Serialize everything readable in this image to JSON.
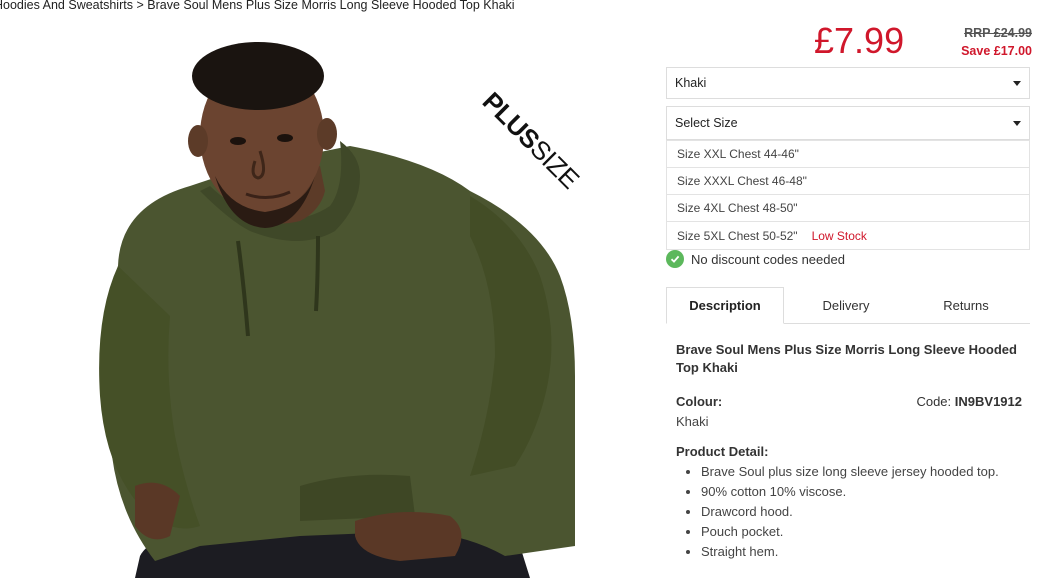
{
  "breadcrumb": {
    "parent": "Hoodies And Sweatshirts",
    "separator": ">",
    "current": "Brave Soul Mens Plus Size Morris Long Sleeve Hooded Top Khaki"
  },
  "badge": {
    "bold": "PLUS",
    "light": "SIZE"
  },
  "price": {
    "now": "£7.99",
    "rrp": "RRP £24.99",
    "save": "Save £17.00",
    "accent_color": "#d0172b"
  },
  "colour_select": {
    "value": "Khaki"
  },
  "size_select": {
    "placeholder": "Select Size",
    "options": [
      {
        "label": "Size XXL Chest 44-46\"",
        "note": ""
      },
      {
        "label": "Size XXXL Chest 46-48\"",
        "note": ""
      },
      {
        "label": "Size 4XL Chest 48-50\"",
        "note": ""
      },
      {
        "label": "Size 5XL Chest 50-52\"",
        "note": "Low Stock"
      }
    ]
  },
  "discount": {
    "text": "No discount codes needed",
    "icon": "check-circle-icon"
  },
  "tabs": [
    {
      "label": "Description",
      "active": true
    },
    {
      "label": "Delivery",
      "active": false
    },
    {
      "label": "Returns",
      "active": false
    }
  ],
  "description": {
    "title": "Brave Soul Mens Plus Size Morris Long Sleeve Hooded Top Khaki",
    "colour_label": "Colour:",
    "colour_value": "Khaki",
    "code_label": "Code:",
    "code_value": "IN9BV1912",
    "detail_label": "Product Detail:",
    "details": [
      "Brave Soul plus size long sleeve jersey hooded top.",
      "90% cotton 10% viscose.",
      "Drawcord hood.",
      "Pouch pocket.",
      "Straight hem."
    ]
  }
}
